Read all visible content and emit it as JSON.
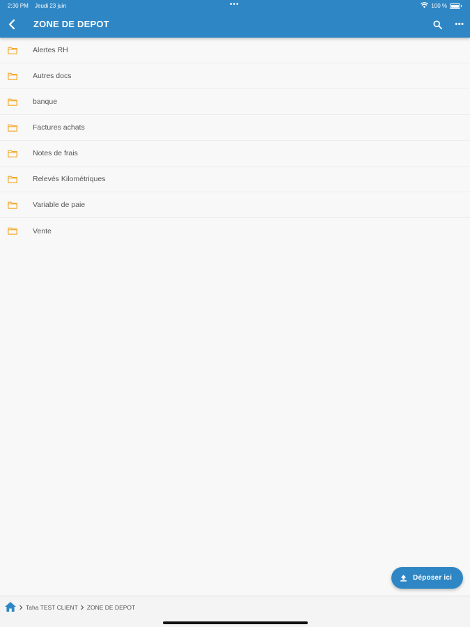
{
  "status_bar": {
    "time": "2:30 PM",
    "date": "Jeudi 23 juin",
    "center_dots": "•••",
    "battery": "100 %",
    "icons": [
      "wifi-icon",
      "battery-icon"
    ]
  },
  "navbar": {
    "title": "ZONE DE DEPOT",
    "back_icon": "chevron-left-icon",
    "search_icon": "search-icon",
    "more_icon": "more-dots-icon",
    "more_glyph": "•••"
  },
  "folders": [
    {
      "name": "Alertes RH"
    },
    {
      "name": "Autres docs"
    },
    {
      "name": "banque"
    },
    {
      "name": "Factures achats"
    },
    {
      "name": "Notes de frais"
    },
    {
      "name": "Relevés Kilométriques"
    },
    {
      "name": "Variable de paie"
    },
    {
      "name": "Vente"
    }
  ],
  "fab": {
    "label": "Déposer ici",
    "icon": "upload-icon"
  },
  "breadcrumb": {
    "home_icon": "home-icon",
    "items": [
      "Taha TEST CLIENT",
      "ZONE DE DEPOT"
    ]
  },
  "colors": {
    "primary": "#2f86c4",
    "folder": "#f5a623",
    "background": "#f8f8f8"
  }
}
